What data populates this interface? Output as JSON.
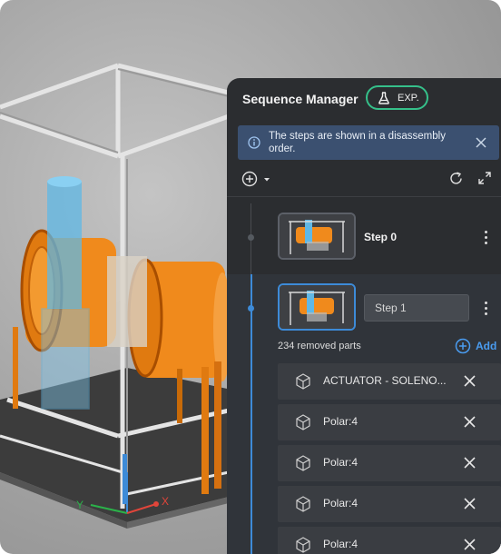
{
  "panel": {
    "title": "Sequence Manager",
    "badge_label": "EXP.",
    "info_text": "The steps are shown in a disassembly order.",
    "steps": [
      {
        "name": "Step 0"
      },
      {
        "name": "Step 1",
        "removed_parts": "234 removed parts",
        "add_label": "Add"
      }
    ],
    "parts": [
      {
        "label": "ACTUATOR - SOLENO..."
      },
      {
        "label": "Polar:4"
      },
      {
        "label": "Polar:4"
      },
      {
        "label": "Polar:4"
      },
      {
        "label": "Polar:4"
      }
    ]
  },
  "viewport": {
    "axis_x": "X",
    "axis_y": "Y"
  },
  "colors": {
    "accent": "#3d8bd8",
    "badge": "#35c08a",
    "model_orange": "#f08a1c",
    "highlight_blue": "#5fb8e6"
  },
  "icons": [
    "flask-icon",
    "info-icon",
    "close-icon",
    "add-circle-icon",
    "caret-down-icon",
    "refresh-icon",
    "expand-icon",
    "kebab-icon",
    "cube-icon",
    "remove-icon"
  ]
}
